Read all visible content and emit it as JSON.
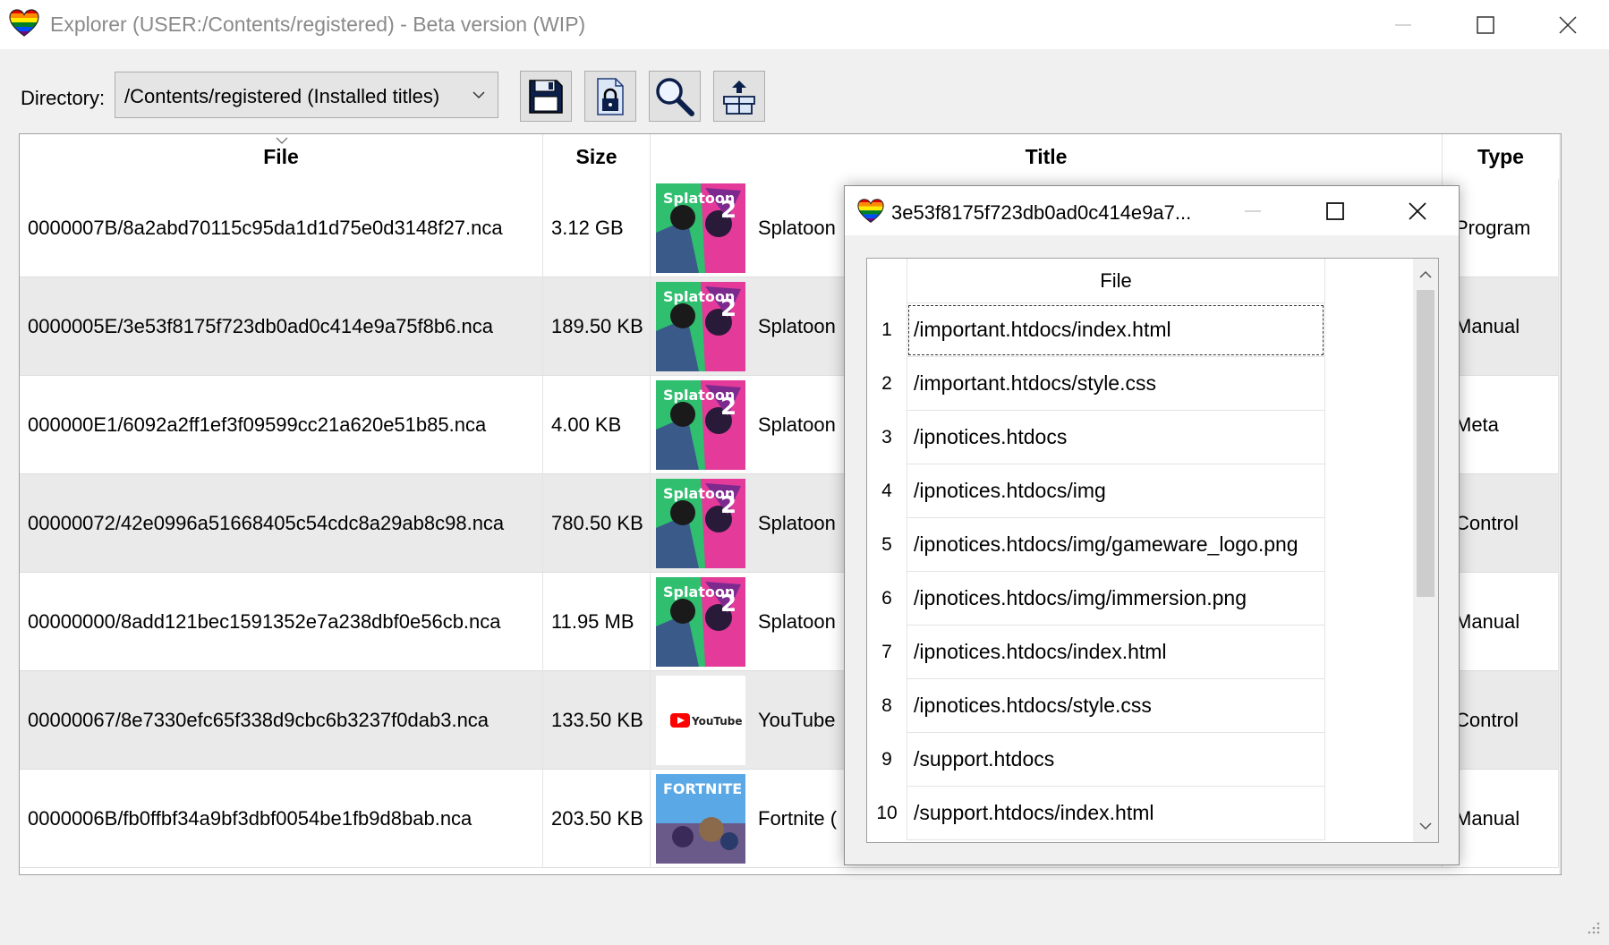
{
  "window": {
    "title": "Explorer (USER:/Contents/registered) - Beta version (WIP)"
  },
  "toolbar": {
    "directory_label": "Directory:",
    "directory_value": "/Contents/registered (Installed titles)",
    "buttons": [
      "save-icon",
      "lock-icon",
      "search-icon",
      "package-icon"
    ]
  },
  "table": {
    "columns": [
      "File",
      "Size",
      "Title",
      "Type"
    ],
    "rows": [
      {
        "file": "0000007B/8a2abd70115c95da1d1d75e0d3148f27.nca",
        "size": "3.12 GB",
        "title": "Splatoon",
        "type": "Program",
        "thumb": "splatoon"
      },
      {
        "file": "0000005E/3e53f8175f723db0ad0c414e9a75f8b6.nca",
        "size": "189.50 KB",
        "title": "Splatoon",
        "type": "Manual",
        "thumb": "splatoon"
      },
      {
        "file": "000000E1/6092a2ff1ef3f09599cc21a620e51b85.nca",
        "size": "4.00 KB",
        "title": "Splatoon",
        "type": "Meta",
        "thumb": "splatoon"
      },
      {
        "file": "00000072/42e0996a51668405c54cdc8a29ab8c98.nca",
        "size": "780.50 KB",
        "title": "Splatoon",
        "type": "Control",
        "thumb": "splatoon"
      },
      {
        "file": "00000000/8add121bec1591352e7a238dbf0e56cb.nca",
        "size": "11.95 MB",
        "title": "Splatoon",
        "type": "Manual",
        "thumb": "splatoon"
      },
      {
        "file": "00000067/8e7330efc65f338d9cbc6b3237f0dab3.nca",
        "size": "133.50 KB",
        "title": "YouTube",
        "type": "Control",
        "thumb": "youtube"
      },
      {
        "file": "0000006B/fb0ffbf34a9bf3dbf0054be1fb9d8bab.nca",
        "size": "203.50 KB",
        "title": "Fortnite (",
        "type": "Manual",
        "thumb": "fortnite"
      }
    ]
  },
  "dialog": {
    "title": "3e53f8175f723db0ad0c414e9a7...",
    "column": "File",
    "rows": [
      {
        "n": "1",
        "file": "/important.htdocs/index.html"
      },
      {
        "n": "2",
        "file": "/important.htdocs/style.css"
      },
      {
        "n": "3",
        "file": "/ipnotices.htdocs"
      },
      {
        "n": "4",
        "file": "/ipnotices.htdocs/img"
      },
      {
        "n": "5",
        "file": "/ipnotices.htdocs/img/gameware_logo.png"
      },
      {
        "n": "6",
        "file": "/ipnotices.htdocs/img/immersion.png"
      },
      {
        "n": "7",
        "file": "/ipnotices.htdocs/index.html"
      },
      {
        "n": "8",
        "file": "/ipnotices.htdocs/style.css"
      },
      {
        "n": "9",
        "file": "/support.htdocs"
      },
      {
        "n": "10",
        "file": "/support.htdocs/index.html"
      }
    ]
  },
  "thumbs": {
    "youtube_text": "YouTube",
    "fortnite_text": "FORTNITE"
  },
  "colors": {
    "accent": "#0a0a0a",
    "alt_row": "#eaeaea",
    "youtube_red": "#ff0000"
  }
}
